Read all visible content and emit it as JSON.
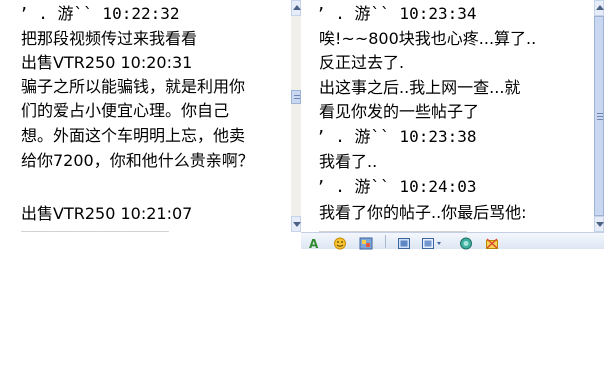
{
  "left_chat": {
    "lines": [
      {
        "kind": "header",
        "text": "’ . 游`` 10:22:32"
      },
      {
        "kind": "body",
        "text": "把那段视频传过来我看看"
      },
      {
        "kind": "header",
        "text": "出售VTR250 10:20:31"
      },
      {
        "kind": "body",
        "text": "骗子之所以能骗钱，就是利用你"
      },
      {
        "kind": "body",
        "text": "们的爱占小便宜心理。你自己"
      },
      {
        "kind": "body",
        "text": "想。外面这个车明明上忘，他卖"
      },
      {
        "kind": "body",
        "text": "给你7200，你和他什么贵亲啊？"
      },
      {
        "kind": "body",
        "text": ""
      },
      {
        "kind": "header",
        "text": "出售VTR250 10:21:07"
      }
    ]
  },
  "right_chat": {
    "lines": [
      {
        "kind": "header",
        "text": "’ . 游`` 10:23:34"
      },
      {
        "kind": "body",
        "text": "唉!~~800块我也心疼...算了.."
      },
      {
        "kind": "body",
        "text": "反正过去了."
      },
      {
        "kind": "body",
        "text": "出这事之后..我上网一查...就"
      },
      {
        "kind": "body",
        "text": "看见你发的一些帖子了"
      },
      {
        "kind": "header",
        "text": "’ . 游`` 10:23:38"
      },
      {
        "kind": "body",
        "text": "我看了.."
      },
      {
        "kind": "header",
        "text": "’ . 游`` 10:24:03"
      },
      {
        "kind": "body",
        "text": "我看了你的帖子..你最后骂他:"
      }
    ]
  },
  "toolbar": {
    "icons": [
      "font-icon",
      "emoticon-icon",
      "wink-icon",
      "image-icon",
      "screen-capture-icon",
      "color-picker-icon",
      "gift-icon"
    ]
  },
  "colors": {
    "scroll_track": "#f0efe9",
    "scroll_button": "#e6edf8",
    "arrow": "#4d6185",
    "toolbar_top": "#f4f7fc",
    "toolbar_bottom": "#dde6f3"
  }
}
